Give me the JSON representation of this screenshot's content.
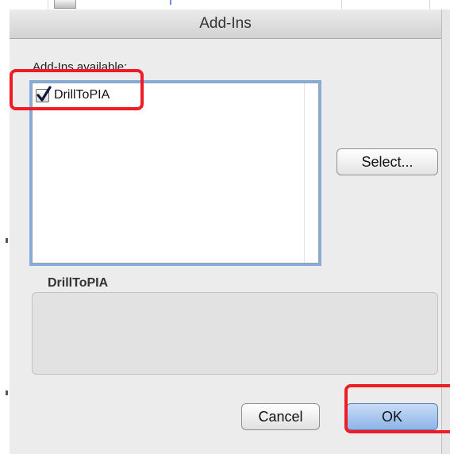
{
  "dialog": {
    "title": "Add-Ins",
    "available_label": "Add-Ins available:",
    "addins": [
      {
        "name": "DrillToPIA",
        "checked": true
      }
    ],
    "select_label": "Select...",
    "description_title": "DrillToPIA",
    "cancel_label": "Cancel",
    "ok_label": "OK"
  },
  "icons": {
    "checkbox": "checkmark-icon"
  },
  "colors": {
    "highlight": "#ee1c24",
    "focus_ring": "#86acdc",
    "default_button": "#8db4e8"
  }
}
